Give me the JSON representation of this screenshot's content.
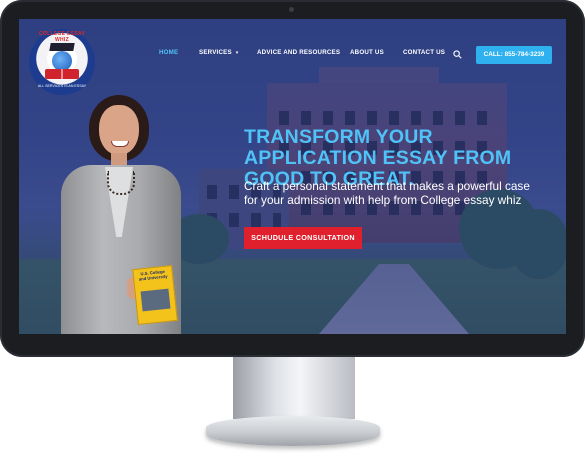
{
  "logo": {
    "top_text": "COLLEGE ESSAY WHIZ",
    "bottom_text": "ALL SERVICES IS AN ESSAY"
  },
  "nav": {
    "items": [
      {
        "label": "HOME",
        "active": true
      },
      {
        "label": "SERVICES",
        "has_dropdown": true
      },
      {
        "label": "ADVICE AND RESOURCES"
      },
      {
        "label": "ABOUT US"
      },
      {
        "label": "CONTACT US"
      }
    ],
    "search_icon": "search-icon",
    "call_button": "CALL: 855-784-3239"
  },
  "hero": {
    "headline": "TRANSFORM YOUR APPLICATION ESSAY FROM GOOD TO GREAT.",
    "subheadline": "Craft a personal statement that makes a powerful case for your admission with help from College essay whiz",
    "cta_label": "SCHUDULE CONSULTATION",
    "book_title": "U.S. College and University"
  },
  "colors": {
    "accent": "#4fc3f7",
    "cta": "#e0202c",
    "call_button": "#2fb1f0"
  }
}
